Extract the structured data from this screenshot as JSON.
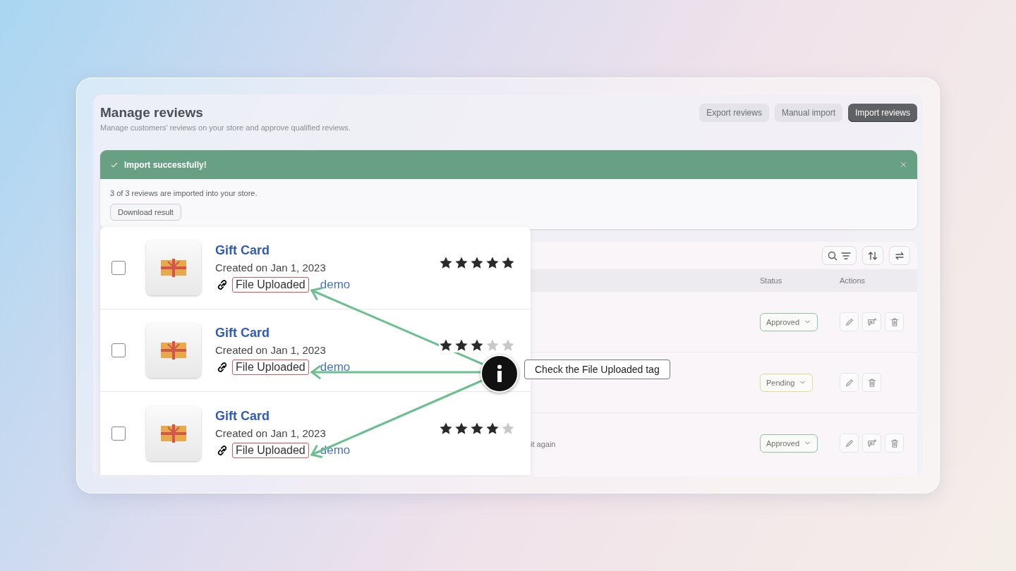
{
  "header": {
    "title": "Manage reviews",
    "subtitle": "Manage customers' reviews on your store and approve qualified reviews.",
    "buttons": [
      {
        "label": "Export reviews",
        "primary": false
      },
      {
        "label": "Manual import",
        "primary": false
      },
      {
        "label": "Import reviews",
        "primary": true
      }
    ]
  },
  "banner": {
    "title": "Import successfully!",
    "message": "3 of 3 reviews are imported into your store.",
    "button": "Download result"
  },
  "table": {
    "columns": [
      "Status",
      "Actions"
    ],
    "rows": [
      {
        "text": "",
        "status": "Approved",
        "color": "#8fc4a3",
        "actions": [
          {
            "kind": "edit"
          },
          {
            "kind": "reply"
          },
          {
            "kind": "delete"
          }
        ]
      },
      {
        "text": "",
        "status": "Pending",
        "color": "#e6d78c",
        "actions": [
          {
            "kind": "edit"
          },
          {
            "kind": "delete"
          }
        ]
      },
      {
        "text": "it again",
        "status": "Approved",
        "color": "#8fc4a3",
        "actions": [
          {
            "kind": "edit"
          },
          {
            "kind": "reply"
          },
          {
            "kind": "delete"
          }
        ]
      }
    ]
  },
  "products": [
    {
      "name": "Gift Card",
      "date": "Created on Jan 1, 2023",
      "tag": "File Uploaded",
      "source": "demo",
      "stars": 5,
      "checked": false
    },
    {
      "name": "Gift Card",
      "date": "Created on Jan 1, 2023",
      "tag": "File Uploaded",
      "source": "demo",
      "stars": 3,
      "checked": false
    },
    {
      "name": "Gift Card",
      "date": "Created on Jan 1, 2023",
      "tag": "File Uploaded",
      "source": "demo",
      "stars": 4,
      "checked": false
    }
  ],
  "callout": {
    "label": "Check the File Uploaded tag"
  }
}
